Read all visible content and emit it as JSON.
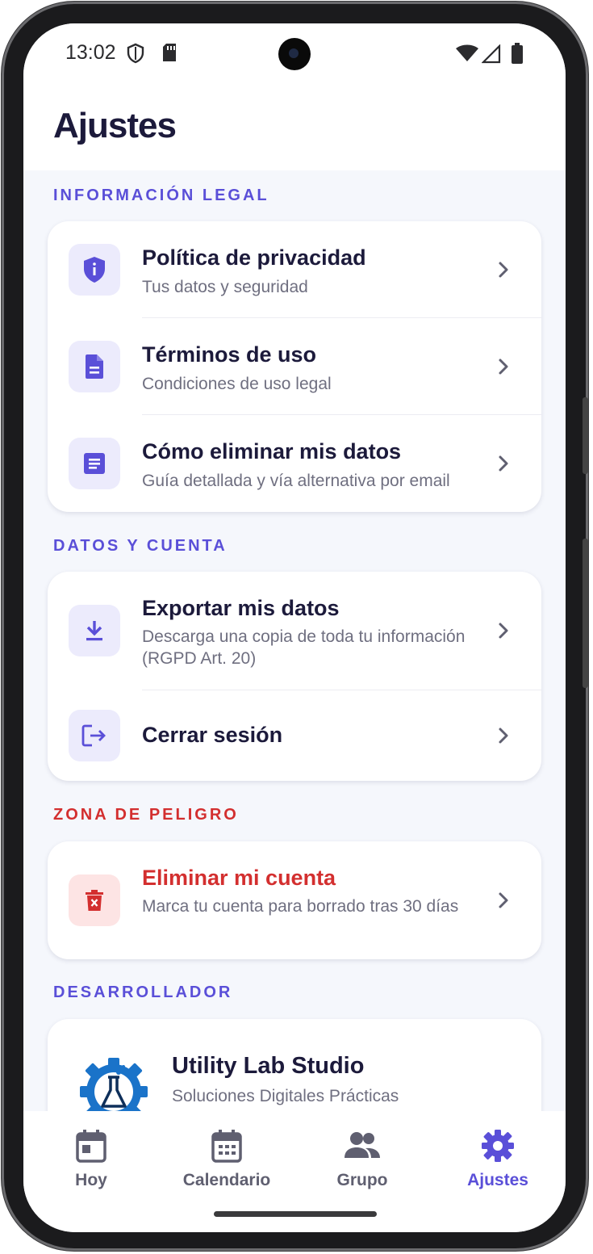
{
  "status": {
    "time": "13:02"
  },
  "header": {
    "title": "Ajustes"
  },
  "sections": {
    "legal": {
      "label": "INFORMACIÓN LEGAL",
      "items": [
        {
          "title": "Política de privacidad",
          "subtitle": "Tus datos y seguridad",
          "icon": "shield-icon"
        },
        {
          "title": "Términos de uso",
          "subtitle": "Condiciones de uso legal",
          "icon": "document-icon"
        },
        {
          "title": "Cómo eliminar mis datos",
          "subtitle": "Guía detallada y vía alternativa por email",
          "icon": "article-icon"
        }
      ]
    },
    "account": {
      "label": "DATOS Y CUENTA",
      "items": [
        {
          "title": "Exportar mis datos",
          "subtitle": "Descarga una copia de toda tu información (RGPD Art. 20)",
          "icon": "download-icon"
        },
        {
          "title": "Cerrar sesión",
          "icon": "logout-icon"
        }
      ]
    },
    "danger": {
      "label": "ZONA DE PELIGRO",
      "items": [
        {
          "title": "Eliminar mi cuenta",
          "subtitle": "Marca tu cuenta para borrado tras 30 días",
          "icon": "trash-icon"
        }
      ]
    },
    "developer": {
      "label": "DESARROLLADOR",
      "name": "Utility Lab Studio",
      "tagline": "Soluciones Digitales Prácticas"
    }
  },
  "nav": {
    "items": [
      {
        "label": "Hoy",
        "icon": "today-icon",
        "active": false
      },
      {
        "label": "Calendario",
        "icon": "calendar-icon",
        "active": false
      },
      {
        "label": "Grupo",
        "icon": "group-icon",
        "active": false
      },
      {
        "label": "Ajustes",
        "icon": "gear-icon",
        "active": true
      }
    ]
  },
  "colors": {
    "accent": "#5a4fd8",
    "danger": "#d32f2f",
    "text": "#1c1a3b",
    "muted": "#6f6f80"
  }
}
